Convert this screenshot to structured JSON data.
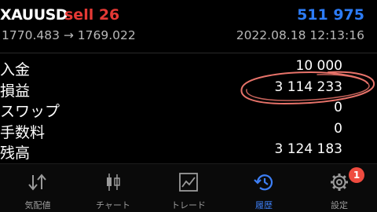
{
  "deal": {
    "symbol": "XAUUSD",
    "type": "sell 26",
    "id": "511 975",
    "prices": "1770.483 → 1769.022",
    "datetime": "2022.08.18 12:13:16"
  },
  "rows": [
    {
      "label": "入金",
      "value": "10 000"
    },
    {
      "label": "損益",
      "value": "3 114 233"
    },
    {
      "label": "スワップ",
      "value": "0"
    },
    {
      "label": "手数料",
      "value": "0"
    },
    {
      "label": "残高",
      "value": "3 124 183"
    }
  ],
  "tabs": [
    {
      "label": "気配値",
      "icon": "arrows-updown-icon"
    },
    {
      "label": "チャート",
      "icon": "candlestick-icon"
    },
    {
      "label": "トレード",
      "icon": "line-chart-icon"
    },
    {
      "label": "履歴",
      "icon": "history-icon",
      "active": true
    },
    {
      "label": "設定",
      "icon": "gear-icon",
      "badge": "1"
    }
  ],
  "colors": {
    "background": "#000000",
    "sell": "#e53935",
    "deal_id": "#2d7cf6",
    "active_tab": "#3d7ff6",
    "inactive_tab": "#9a9a9a",
    "badge": "#ef4b3f",
    "annotation": "#e8736a"
  }
}
